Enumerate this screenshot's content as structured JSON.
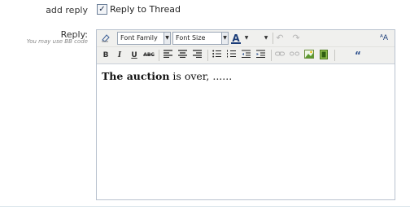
{
  "form": {
    "add_reply_label": "add reply",
    "reply_to_thread_label": "Reply to Thread",
    "reply_to_thread_checked": true,
    "reply_label": "Reply:",
    "bb_code_hint": "You may use BB code"
  },
  "toolbar": {
    "font_family": "Font Family",
    "font_size": "Font Size",
    "row1_icons": [
      "eraser-icon",
      "font-color-icon",
      "undo-icon",
      "redo-icon",
      "text-size-icon"
    ],
    "row2_icons": [
      "bold-icon",
      "italic-icon",
      "underline-icon",
      "strikethrough-icon",
      "align-left-icon",
      "align-center-icon",
      "align-right-icon",
      "bullet-list-icon",
      "numbered-list-icon",
      "outdent-icon",
      "indent-icon",
      "link-icon",
      "unlink-icon",
      "image-icon",
      "media-icon",
      "quote-icon"
    ],
    "bold": "B",
    "italic": "I",
    "underline": "U",
    "strike": "ABC",
    "font_color": "A",
    "quote": "“"
  },
  "editor": {
    "bold_text": "The auction",
    "text": " is over, ......"
  }
}
